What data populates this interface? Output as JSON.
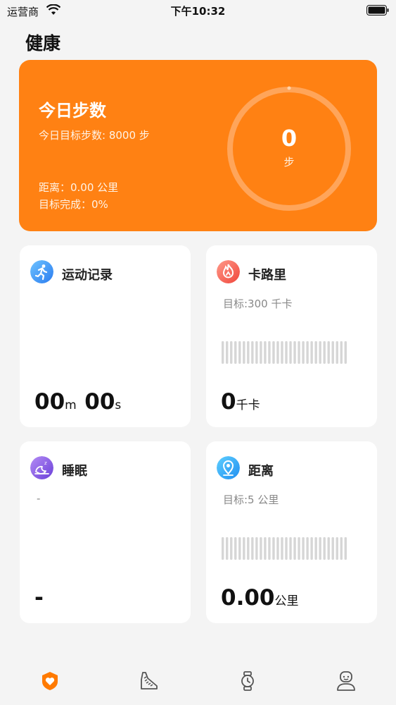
{
  "status_bar": {
    "carrier": "运营商",
    "time": "下午10:32"
  },
  "page": {
    "title": "健康"
  },
  "steps": {
    "title": "今日步数",
    "goal": "今日目标步数: 8000 步",
    "distance": "距离：0.00 公里",
    "completion": "目标完成：0%",
    "value": "0",
    "unit": "步",
    "progress_fraction": 0
  },
  "cards": {
    "workout": {
      "title": "运动记录",
      "minutes": "00",
      "minutes_unit": "m",
      "seconds": "00",
      "seconds_unit": "s"
    },
    "calories": {
      "title": "卡路里",
      "goal": "目标:300 千卡",
      "value": "0",
      "unit": "千卡"
    },
    "sleep": {
      "title": "睡眠",
      "sub": "-",
      "value": "-"
    },
    "distance": {
      "title": "距离",
      "goal": "目标:5 公里",
      "value": "0.00",
      "unit": "公里"
    }
  },
  "colors": {
    "accent": "#ff8113",
    "bar_gray": "#d6d6d6",
    "tab_active": "#ff7a00",
    "tab_inactive": "#555555"
  },
  "tabs": [
    {
      "icon": "heart-shield-icon",
      "active": true
    },
    {
      "icon": "shoe-icon",
      "active": false
    },
    {
      "icon": "watch-icon",
      "active": false
    },
    {
      "icon": "profile-icon",
      "active": false
    }
  ]
}
